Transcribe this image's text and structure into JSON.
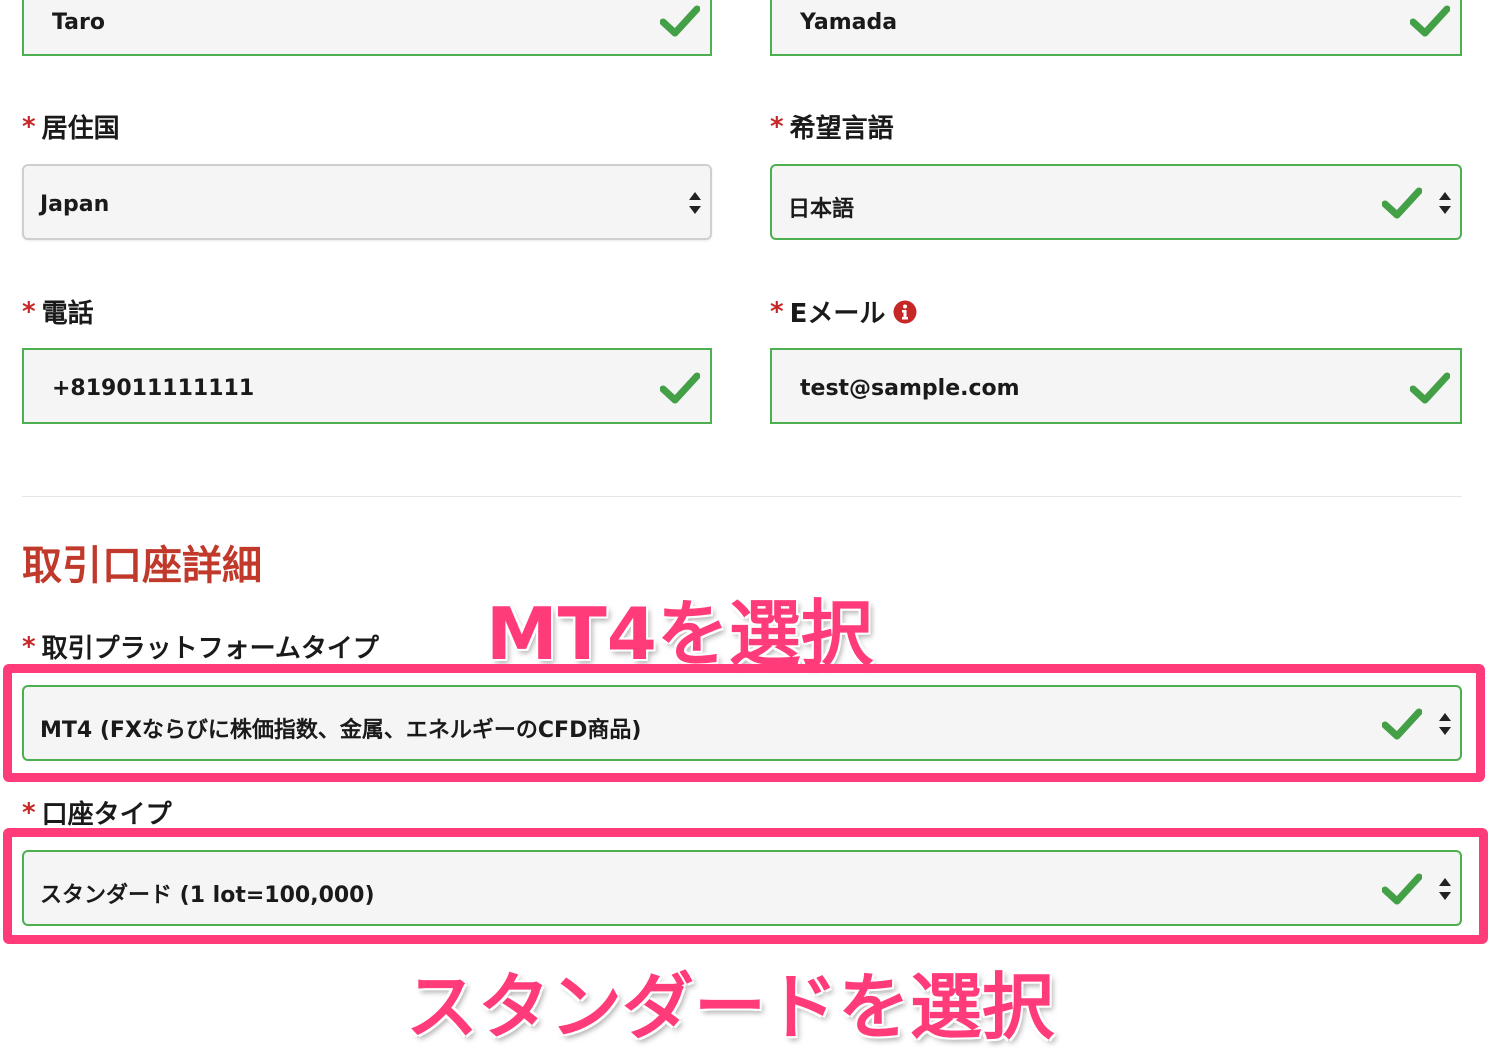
{
  "personal": {
    "first_name_value": "Taro",
    "last_name_value": "Yamada",
    "country_label": "居住国",
    "country_value": "Japan",
    "language_label": "希望言語",
    "language_value": "日本語",
    "phone_label": "電話",
    "phone_value": "+819011111111",
    "email_label": "Eメール",
    "email_value": "test@sample.com",
    "required_mark": "*"
  },
  "account": {
    "section_title": "取引口座詳細",
    "platform_label": "取引プラットフォームタイプ",
    "platform_value": "MT4 (FXならびに株価指数、金属、エネルギーのCFD商品)",
    "account_type_label": "口座タイプ",
    "account_type_value": "スタンダード (1 lot=100,000)"
  },
  "annotations": {
    "platform_note": "MT4を選択",
    "account_type_note": "スタンダードを選択"
  },
  "colors": {
    "valid_border": "#4caf50",
    "check": "#43a047",
    "required": "#c62828",
    "section_title": "#c0392b",
    "highlight": "#ff3b7a",
    "info_icon": "#c62828"
  },
  "icons": {
    "valid": "check-icon",
    "select": "select-arrows-icon",
    "info": "info-icon"
  }
}
